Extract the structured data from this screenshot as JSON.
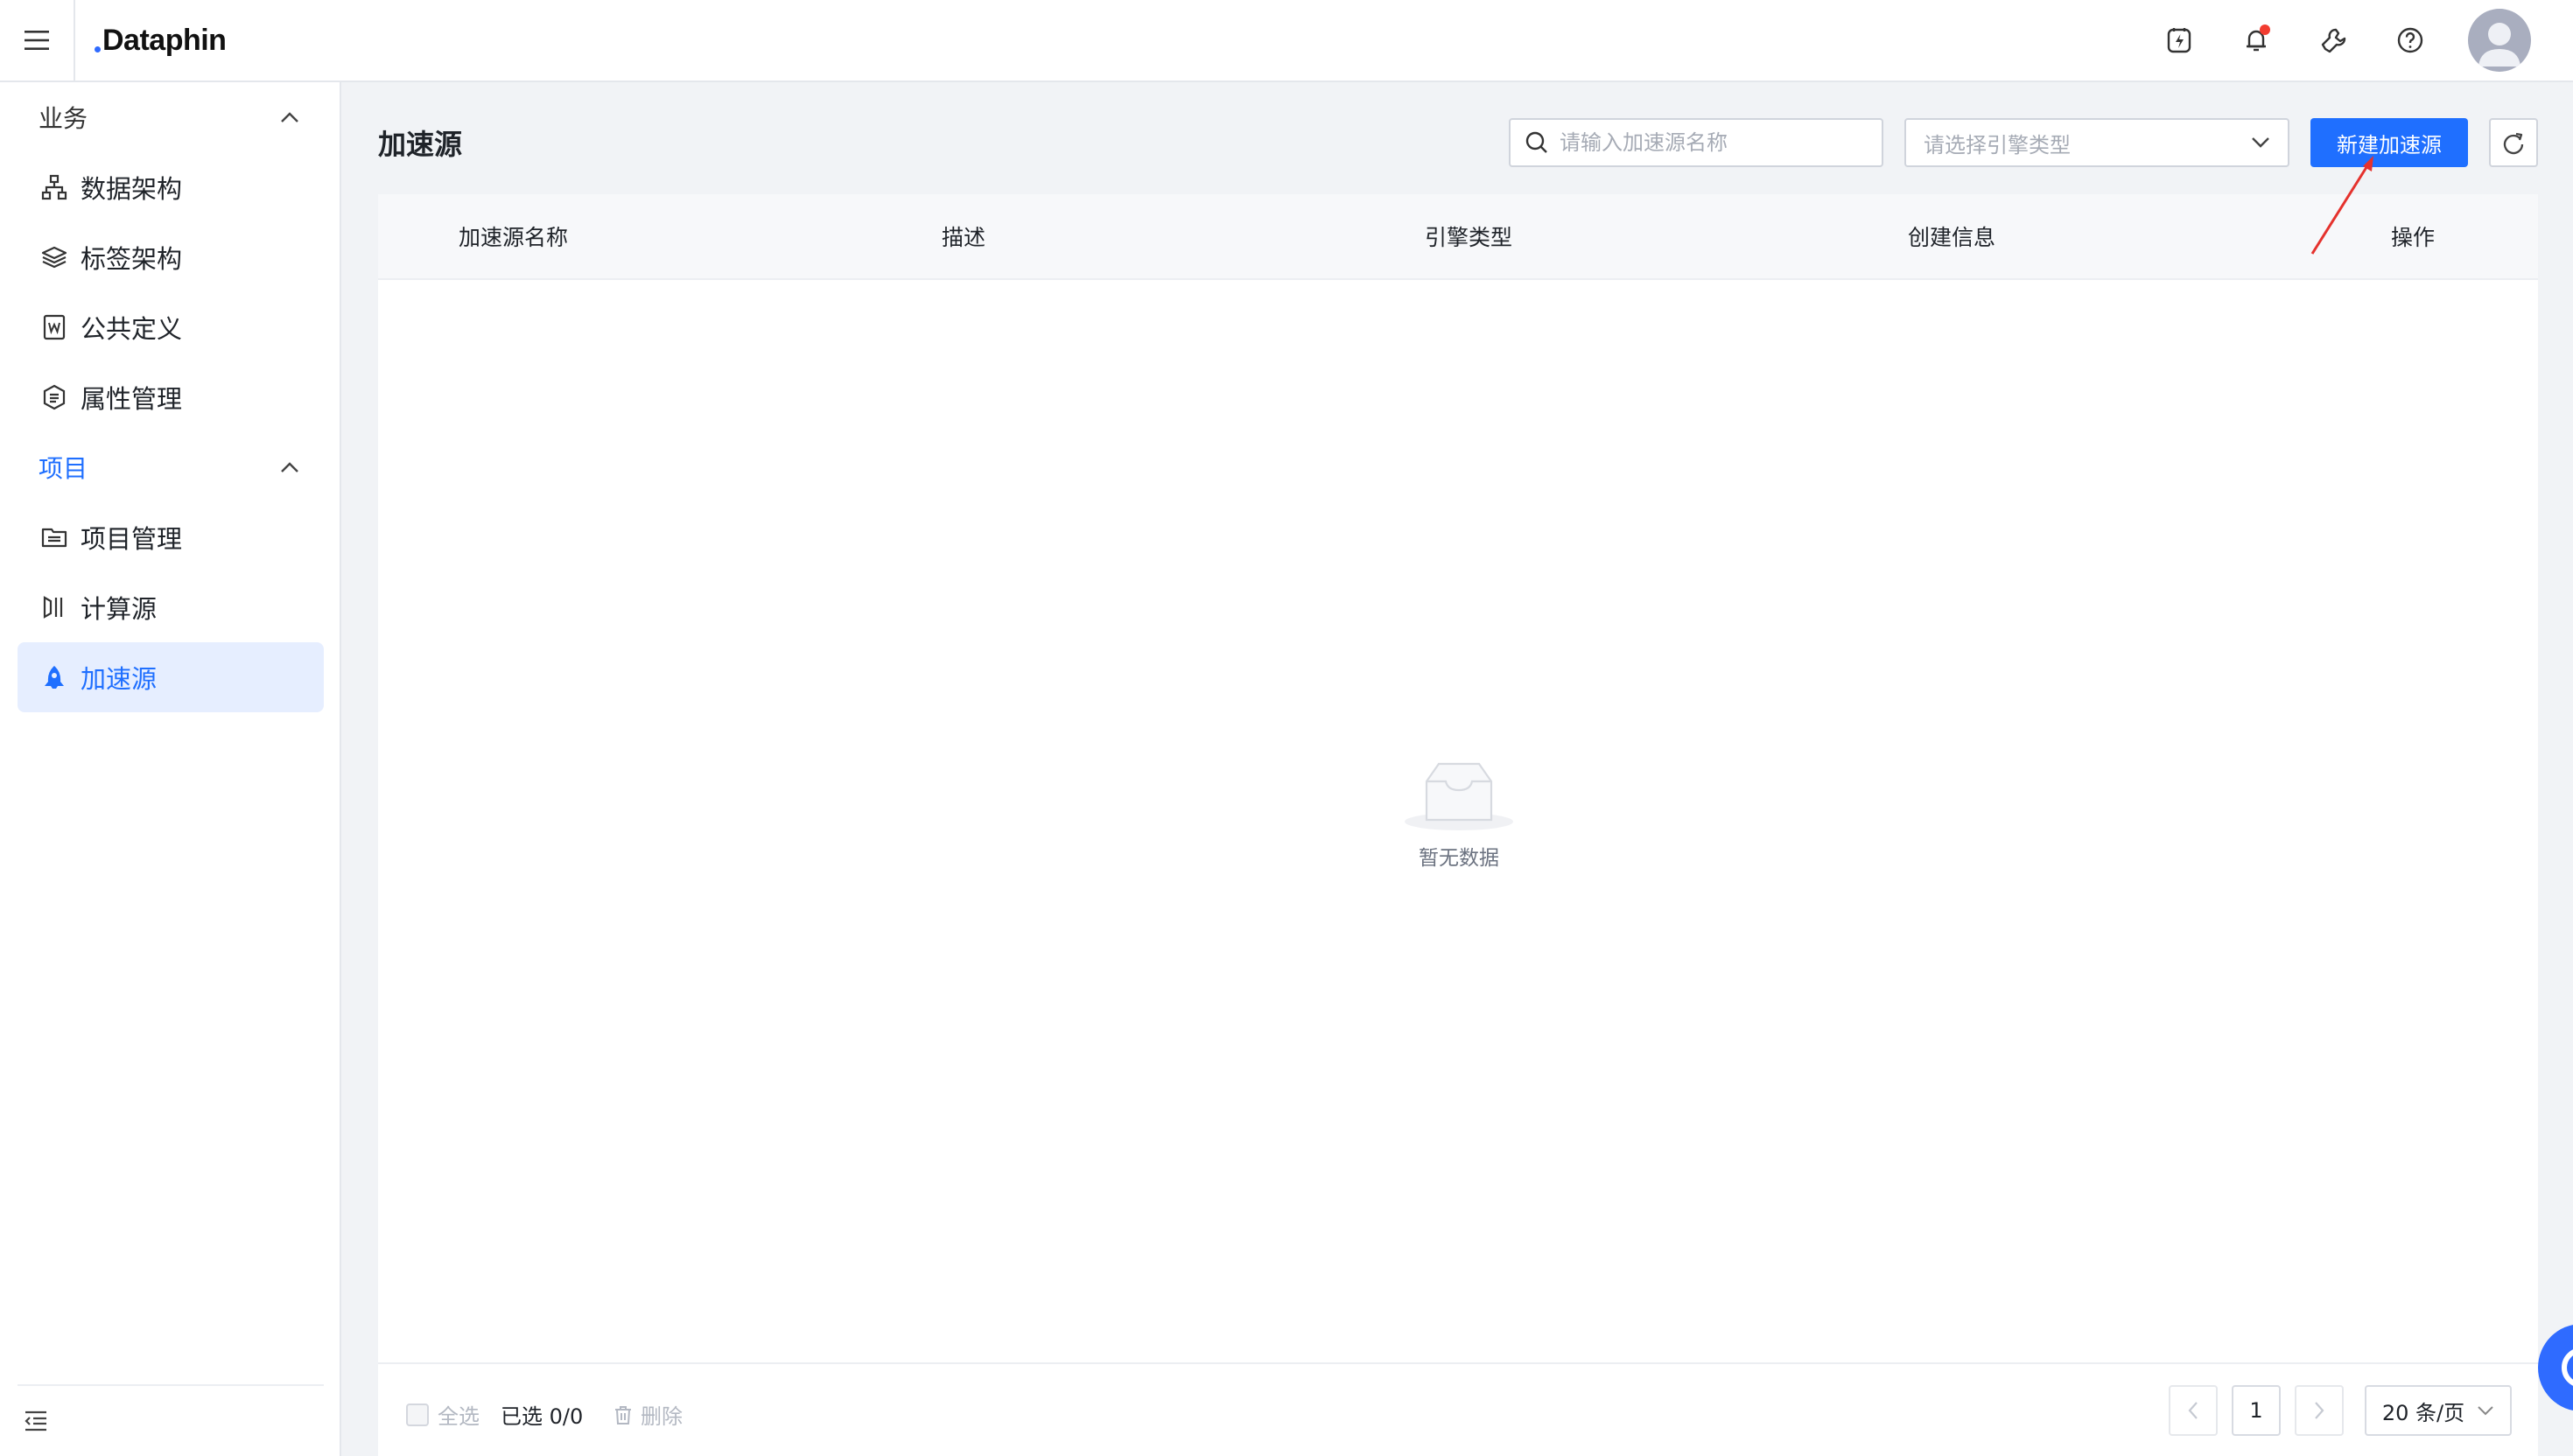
{
  "header": {
    "logo_text": "Dataphin",
    "icons": [
      "menu-icon",
      "lightning-icon",
      "bell-icon",
      "wrench-icon",
      "help-icon",
      "avatar"
    ]
  },
  "sidebar": {
    "sections": [
      {
        "label": "业务",
        "expanded": true,
        "items": [
          {
            "label": "数据架构",
            "icon": "hierarchy-icon"
          },
          {
            "label": "标签架构",
            "icon": "layers-icon"
          },
          {
            "label": "公共定义",
            "icon": "word-doc-icon"
          },
          {
            "label": "属性管理",
            "icon": "attribute-icon"
          }
        ]
      },
      {
        "label": "项目",
        "expanded": true,
        "items": [
          {
            "label": "项目管理",
            "icon": "folder-icon"
          },
          {
            "label": "计算源",
            "icon": "compute-source-icon"
          },
          {
            "label": "加速源",
            "icon": "rocket-icon",
            "selected": true
          }
        ]
      }
    ]
  },
  "page": {
    "title": "加速源",
    "search_placeholder": "请输入加速源名称",
    "engine_select_placeholder": "请选择引擎类型",
    "create_button": "新建加速源"
  },
  "table": {
    "columns": [
      "加速源名称",
      "描述",
      "引擎类型",
      "创建信息",
      "操作"
    ],
    "rows": [],
    "empty_text": "暂无数据"
  },
  "footer": {
    "select_all": "全选",
    "selected_count": "已选 0/0",
    "delete": "删除",
    "current_page": "1",
    "page_size": "20 条/页"
  },
  "colors": {
    "primary": "#1f6fff",
    "notification_dot": "#f23c30",
    "selected_bg": "#e6eeff"
  }
}
